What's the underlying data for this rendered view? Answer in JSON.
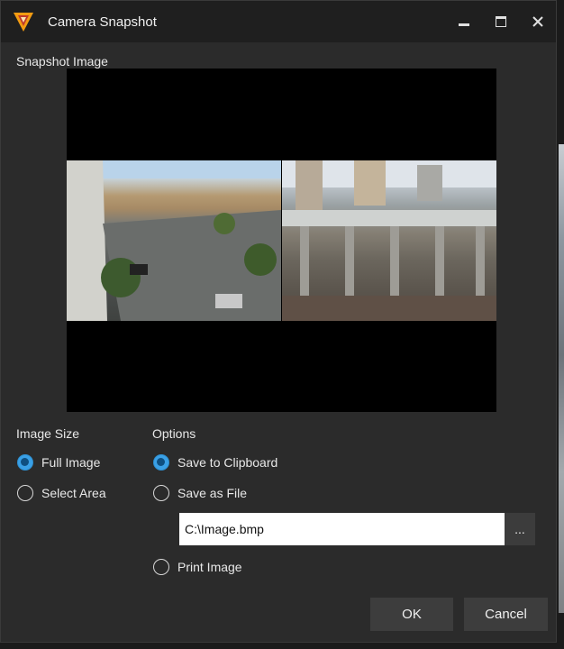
{
  "window": {
    "title": "Camera Snapshot"
  },
  "snapshot": {
    "label": "Snapshot Image"
  },
  "image_size": {
    "label": "Image Size",
    "options": [
      {
        "label": "Full Image",
        "checked": true
      },
      {
        "label": "Select Area",
        "checked": false
      }
    ]
  },
  "options": {
    "label": "Options",
    "save_to_clipboard": "Save to Clipboard",
    "save_as_file": "Save as File",
    "print_image": "Print Image",
    "file_path": "C:\\Image.bmp",
    "browse_label": "..."
  },
  "buttons": {
    "ok": "OK",
    "cancel": "Cancel"
  },
  "colors": {
    "accent": "#3aa0e6",
    "logo": "#f39c12",
    "background": "#2b2b2b",
    "titlebar": "#1f1f1f"
  }
}
